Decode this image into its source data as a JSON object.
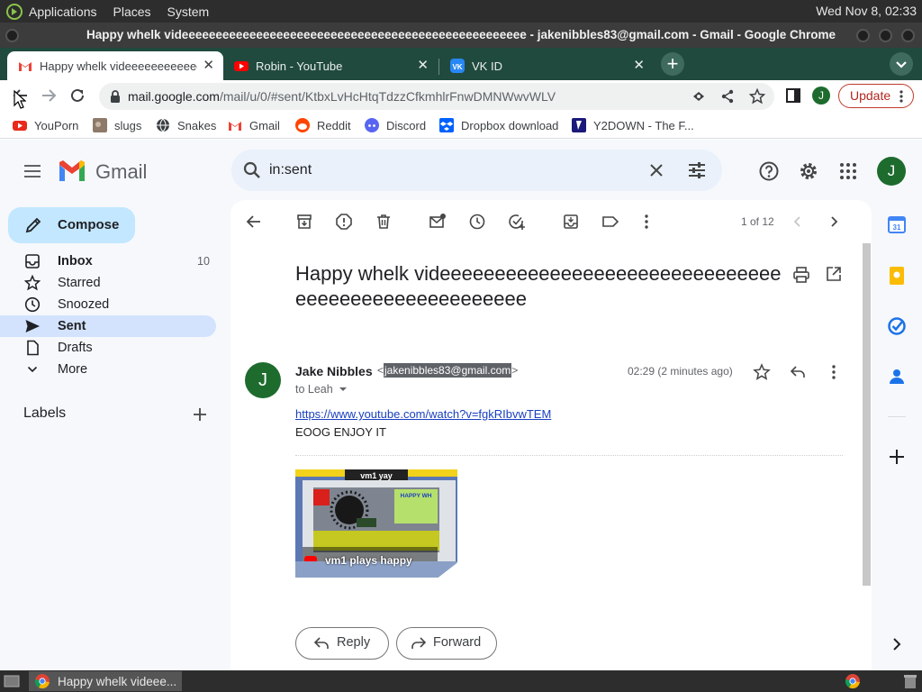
{
  "os_panel": {
    "menus": [
      "Applications",
      "Places",
      "System"
    ],
    "clock": "Wed Nov  8, 02:33"
  },
  "window": {
    "title": "Happy whelk videeeeeeeeeeeeeeeeeeeeeeeeeeeeeeeeeeeeeeeeeeeeeeeeeee - jakenibbles83@gmail.com - Gmail - Google Chrome"
  },
  "tabs": [
    {
      "title": "Happy whelk videeeeeeeeeeeeeeeeeeeeeeeee",
      "favicon": "gmail-icon",
      "active": true
    },
    {
      "title": "Robin - YouTube",
      "favicon": "youtube-icon",
      "active": false
    },
    {
      "title": "VK ID",
      "favicon": "vk-icon",
      "active": false
    }
  ],
  "toolbar": {
    "url_host": "mail.google.com",
    "url_path": "/mail/u/0/#sent/KtbxLvHcHtqTdzzCfkmhlrFnwDMNWwvWLV",
    "profile_initial": "J",
    "update_label": "Update"
  },
  "bookmarks": [
    {
      "label": "YouPorn",
      "icon": "youporn-icon"
    },
    {
      "label": "slugs",
      "icon": "slugs-icon"
    },
    {
      "label": "Snakes",
      "icon": "globe-icon"
    },
    {
      "label": "Gmail",
      "icon": "gmail-icon"
    },
    {
      "label": "Reddit",
      "icon": "reddit-icon"
    },
    {
      "label": "Discord",
      "icon": "discord-icon"
    },
    {
      "label": "Dropbox download",
      "icon": "dropbox-icon"
    },
    {
      "label": "Y2DOWN - The F...",
      "icon": "y2down-icon"
    }
  ],
  "gmail": {
    "product": "Gmail",
    "search_value": "in:sent",
    "avatar_initial": "J",
    "compose_label": "Compose",
    "nav": [
      {
        "label": "Inbox",
        "count": "10",
        "icon": "inbox-icon"
      },
      {
        "label": "Starred",
        "count": "",
        "icon": "star-icon"
      },
      {
        "label": "Snoozed",
        "count": "",
        "icon": "clock-icon"
      },
      {
        "label": "Sent",
        "count": "",
        "icon": "send-icon"
      },
      {
        "label": "Drafts",
        "count": "",
        "icon": "draft-icon"
      },
      {
        "label": "More",
        "count": "",
        "icon": "chevron-down-icon"
      }
    ],
    "labels_title": "Labels",
    "pager": "1 of 12"
  },
  "email": {
    "subject": "Happy whelk videeeeeeeeeeeeeeeeeeeeeeeeeeeeeeeeeeeeeeeeeeeeeeeeeeee",
    "sender_initial": "J",
    "sender_name": "Jake Nibbles",
    "sender_email_open": "<",
    "sender_email": "jakenibbles83@gmail.com",
    "sender_email_close": ">",
    "to": "to Leah",
    "time": "02:29 (2 minutes ago)",
    "link": "https://www.youtube.com/watch?v=fgkRIbvwTEM",
    "body": "EOOG ENJOY IT",
    "video_title": "vm1 plays happy",
    "reply_label": "Reply",
    "forward_label": "Forward"
  },
  "taskbar": {
    "window_label": "Happy whelk videee..."
  },
  "colors": {
    "tab_strip": "#214a3f",
    "compose": "#c2e7ff",
    "active_nav": "#d3e3fd",
    "avatar": "#1e6b2e",
    "update": "#b3261e"
  }
}
